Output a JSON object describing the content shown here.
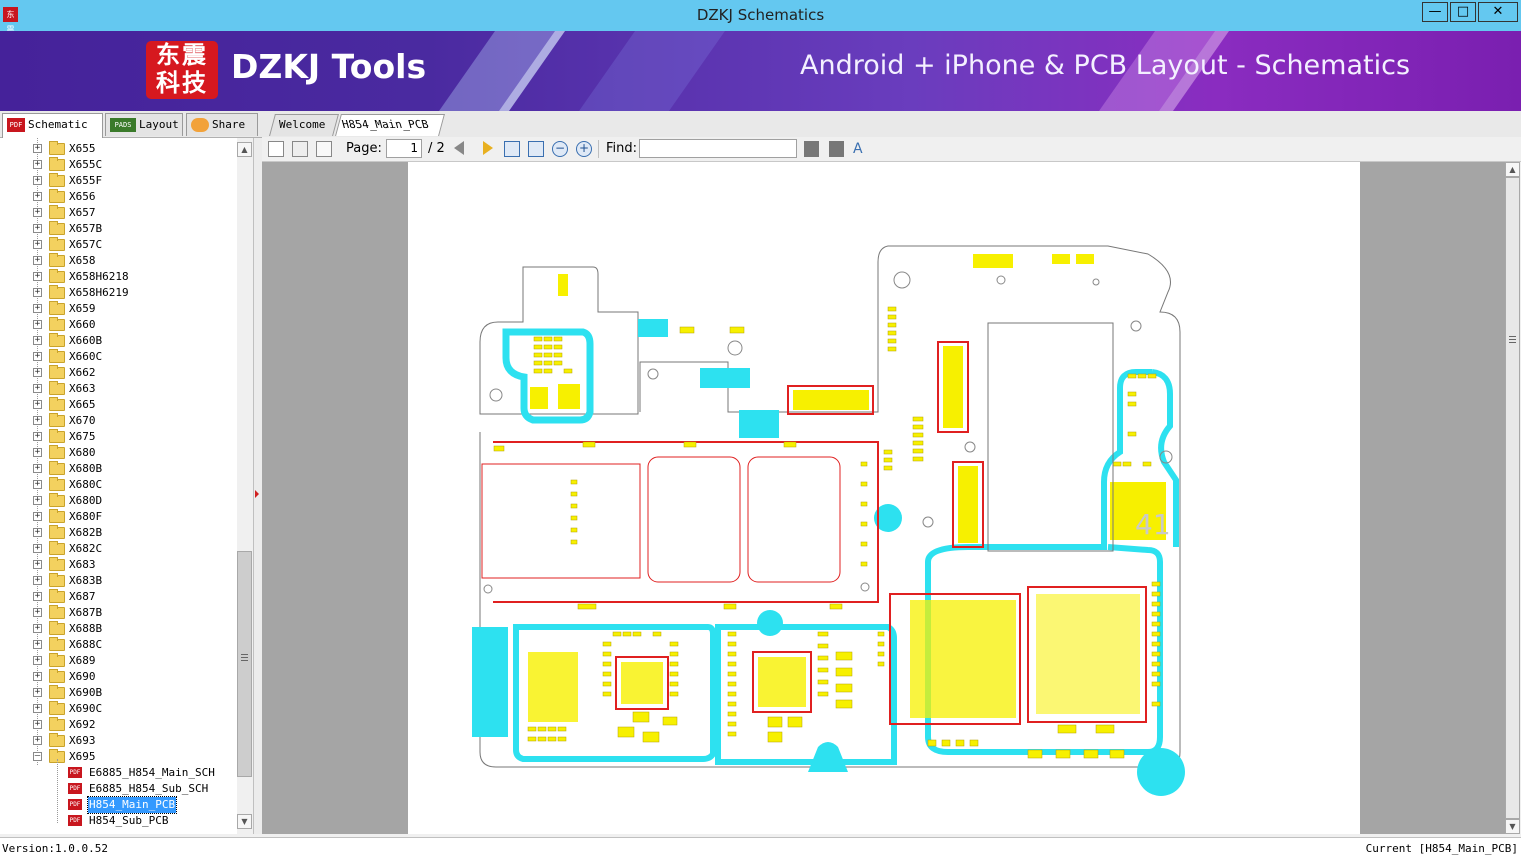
{
  "window": {
    "title": "DZKJ Schematics",
    "app_icon_text": "东震"
  },
  "banner": {
    "logo_glyphs": "东震科技",
    "logo_text": "DZKJ Tools",
    "tagline": "Android + iPhone & PCB Layout - Schematics"
  },
  "left_tabs": [
    {
      "label": "Schematic",
      "icon": "pdf-icon",
      "badge": "PDF"
    },
    {
      "label": "Layout",
      "icon": "pads-icon",
      "badge": "PADS"
    },
    {
      "label": "Share",
      "icon": "cloud-share-icon"
    }
  ],
  "doc_tabs": [
    {
      "label": "Welcome"
    },
    {
      "label": "H854_Main_PCB",
      "closable": true
    }
  ],
  "tree": {
    "folders": [
      "X655",
      "X655C",
      "X655F",
      "X656",
      "X657",
      "X657B",
      "X657C",
      "X658",
      "X658H6218",
      "X658H6219",
      "X659",
      "X660",
      "X660B",
      "X660C",
      "X662",
      "X663",
      "X665",
      "X670",
      "X675",
      "X680",
      "X680B",
      "X680C",
      "X680D",
      "X680F",
      "X682B",
      "X682C",
      "X683",
      "X683B",
      "X687",
      "X687B",
      "X688B",
      "X688C",
      "X689",
      "X690",
      "X690B",
      "X690C",
      "X692",
      "X693"
    ],
    "expanded_folder": "X695",
    "files": [
      "E6885_H854_Main_SCH",
      "E6885_H854_Sub_SCH",
      "H854_Main_PCB",
      "H854_Sub_PCB"
    ],
    "selected_file": "H854_Main_PCB",
    "pdf_badge": "PDF"
  },
  "toolbar": {
    "page_label": "Page:",
    "page_current": "1",
    "page_total": "/ 2",
    "find_label": "Find:",
    "find_value": ""
  },
  "status": {
    "version": "Version:1.0.0.52",
    "current": "Current [H854_Main_PCB]"
  },
  "pcb_labels": {
    "big_chip": "41"
  },
  "colors": {
    "titlebar": "#64c8f0",
    "banner": "#4a2aa0",
    "pcb_cyan": "#2de1f0",
    "pcb_red": "#e02020",
    "pcb_yellow": "#f7f000",
    "selection": "#3399ff"
  }
}
